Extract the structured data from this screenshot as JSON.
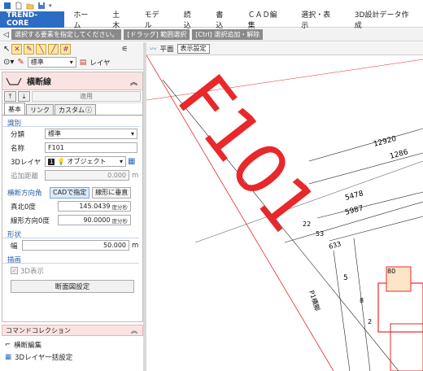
{
  "ribbon": {
    "app_tab": "TREND-CORE",
    "tabs": [
      "ホーム",
      "土木",
      "モデル",
      "読込",
      "書込",
      "ＣＡＤ編集",
      "選択・表示",
      "3D設計データ作成"
    ]
  },
  "hints": [
    "選択する要素を指定してください。",
    "[ドラッグ] 範囲選択",
    "[Ctrl] 選択追加・解除"
  ],
  "toolbar": {
    "standard_combo": "標準",
    "layer_label": "レイヤ"
  },
  "panel": {
    "title": "横断線",
    "apply_label": "適用",
    "tabs": [
      "基本",
      "リンク",
      "カスタム"
    ],
    "section_identify": "識別",
    "class_label": "分類",
    "class_value": "標準",
    "name_label": "名称",
    "name_value": "F101",
    "layer3d_label": "3Dレイヤ",
    "layer3d_num": "1",
    "layer3d_value": "オブジェクト",
    "add_dist_label": "追加距離",
    "add_dist_value": "0.000",
    "add_dist_unit": "m",
    "dir_angle_label": "横断方向角",
    "cad_btn": "CADで指定",
    "perp_btn": "線形に垂直",
    "north_label": "真北0度",
    "north_value": "145.0439",
    "north_unit": "度分秒",
    "line_dir_label": "線形方向0度",
    "line_dir_value": "90.0000",
    "line_dir_unit": "度分秒",
    "section_shape": "形状",
    "width_label": "幅",
    "width_value": "50.000",
    "width_unit": "m",
    "section_draw": "描画",
    "show3d_label": "3D表示",
    "section_setting_btn": "断面図設定"
  },
  "commands": {
    "header": "コマンドコレクション",
    "items": [
      "横断編集",
      "3Dレイヤ一括設定"
    ]
  },
  "view": {
    "plane_label": "平面",
    "display_setting": "表示設定"
  },
  "drawing": {
    "big_label": "F101",
    "dims": [
      "12920",
      "1286",
      "5478",
      "5987",
      "633",
      "53",
      "22",
      "5",
      "80",
      "2",
      "8"
    ],
    "road_label": "P1橋脚"
  },
  "colors": {
    "accent_red": "#e8282a",
    "app_blue": "#2b6cc4",
    "panel_head": "#fbe3e3"
  }
}
